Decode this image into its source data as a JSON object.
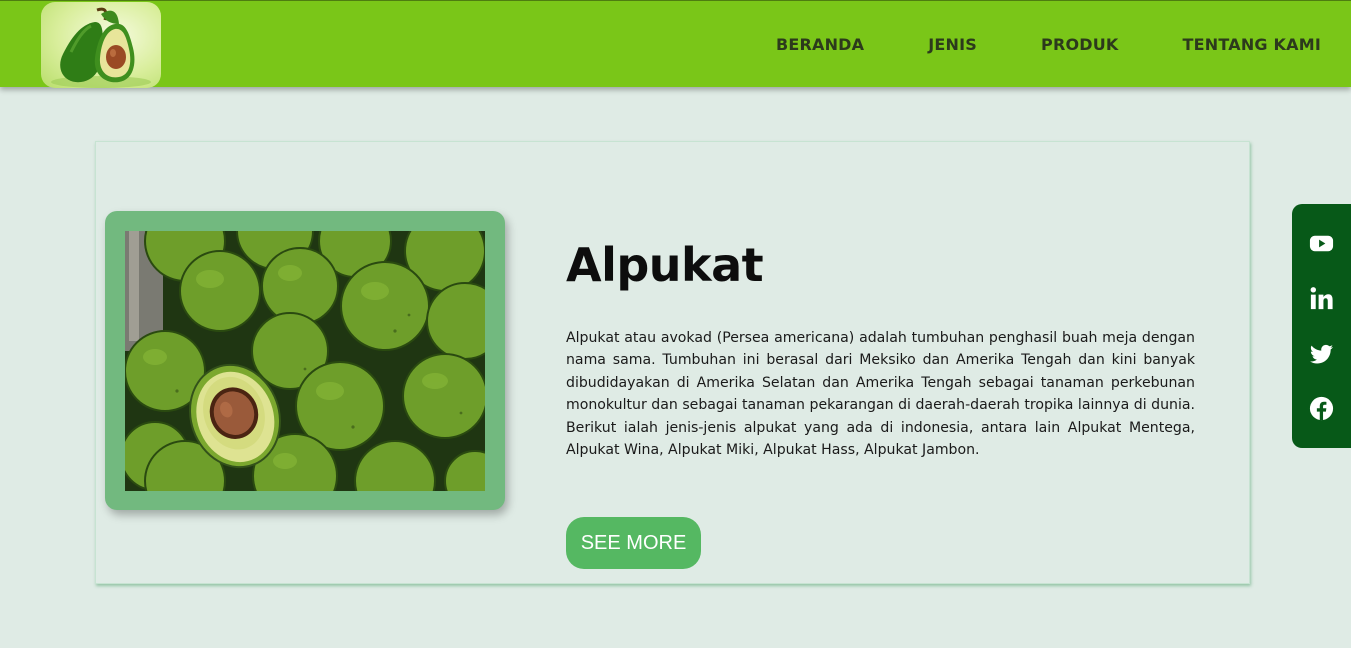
{
  "nav": {
    "logo_icon": "avocado-logo",
    "items": [
      {
        "label": "BERANDA"
      },
      {
        "label": "JENIS"
      },
      {
        "label": "PRODUK"
      },
      {
        "label": "TENTANG KAMI"
      }
    ]
  },
  "hero": {
    "image_icon": "avocado-photo",
    "title": "Alpukat",
    "description": "Alpukat atau avokad (Persea americana) adalah tumbuhan penghasil buah meja dengan nama sama. Tumbuhan ini berasal dari Meksiko dan Amerika Tengah dan kini banyak dibudidayakan di Amerika Selatan dan Amerika Tengah sebagai tanaman perkebunan monokultur dan sebagai tanaman pekarangan di daerah-daerah tropika lainnya di dunia. Berikut ialah jenis-jenis alpukat yang ada di indonesia, antara lain Alpukat Mentega, Alpukat Wina, Alpukat Miki, Alpukat Hass, Alpukat Jambon.",
    "button_label": "SEE MORE"
  },
  "social": {
    "icons": [
      "youtube-icon",
      "linkedin-icon",
      "twitter-icon",
      "facebook-icon"
    ]
  },
  "colors": {
    "header": "#7ac618",
    "page_background": "#dfebe5",
    "image_frame": "#72b97f",
    "button": "#55b862",
    "social_bar": "#075918"
  }
}
